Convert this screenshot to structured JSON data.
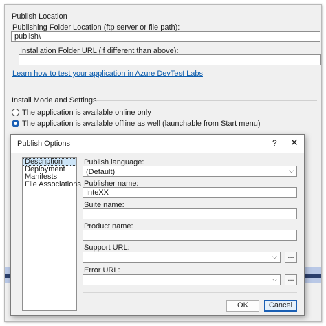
{
  "publish_location": {
    "group_title": "Publish Location",
    "folder_label": "Publishing Folder Location (ftp server or file path):",
    "folder_value": "publish\\",
    "install_url_label": "Installation Folder URL (if different than above):",
    "install_url_value": "",
    "link": "Learn how to test your application in Azure DevTest Labs"
  },
  "install_mode": {
    "group_title": "Install Mode and Settings",
    "online_option": "The application is available online only",
    "offline_option": "The application is available offline as well (launchable from Start menu)"
  },
  "dialog": {
    "title": "Publish Options",
    "help": "?",
    "close": "✕",
    "categories": [
      "Description",
      "Deployment",
      "Manifests",
      "File Associations"
    ],
    "publish_language_label": "Publish language:",
    "publish_language_value": "(Default)",
    "publisher_name_label": "Publisher name:",
    "publisher_name_value": "InteXX",
    "suite_name_label": "Suite name:",
    "suite_name_value": "",
    "product_name_label": "Product name:",
    "product_name_value": "",
    "support_url_label": "Support URL:",
    "support_url_value": "",
    "error_url_label": "Error URL:",
    "error_url_value": "",
    "browse_label": "...",
    "ok_label": "OK",
    "cancel_label": "Cancel"
  },
  "colors": {
    "accent": "#1a5fb4",
    "link": "#0b5cad",
    "window_bg": "#f0f0f0",
    "bar_dark": "#2b3f6c",
    "bar_light": "#b9c8e6"
  }
}
